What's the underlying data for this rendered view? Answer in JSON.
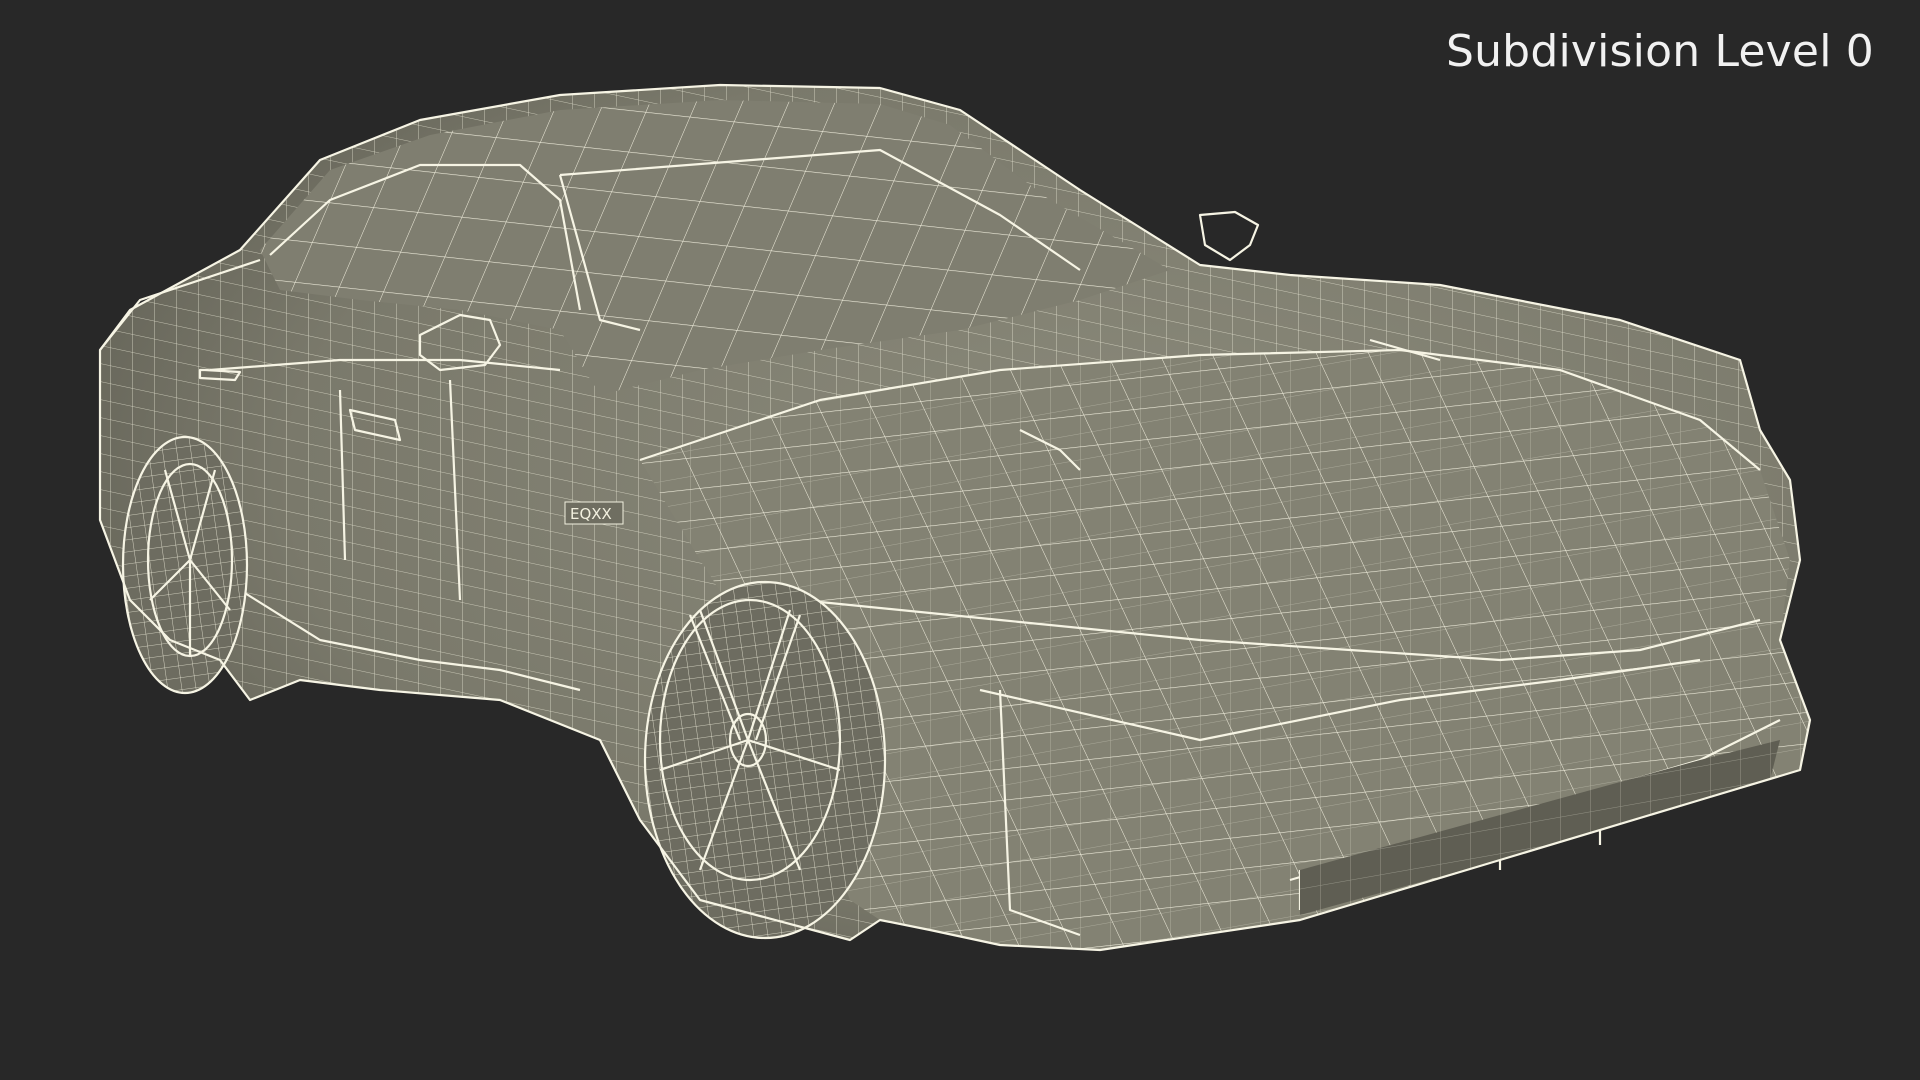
{
  "render": {
    "caption": "Subdivision Level 0",
    "subject": "wireframe car model",
    "badge_text": "EQXX"
  },
  "colors": {
    "background": "#282828",
    "surface": "#7d7c6d",
    "surface_shadow": "#5f5e53",
    "wireframe": "#f2f0df",
    "caption": "#f1f1f1"
  }
}
